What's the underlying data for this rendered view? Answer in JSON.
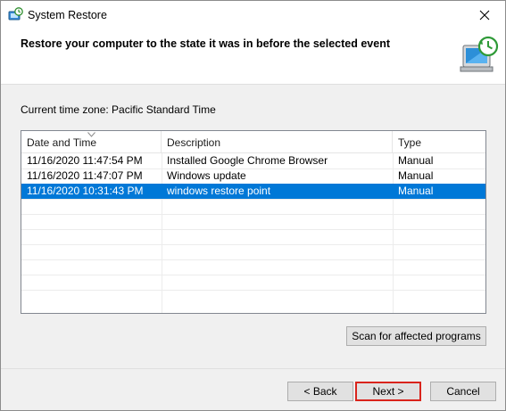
{
  "window": {
    "title": "System Restore"
  },
  "header": {
    "title": "Restore your computer to the state it was in before the selected event"
  },
  "timezone_label": "Current time zone: Pacific Standard Time",
  "table": {
    "columns": [
      "Date and Time",
      "Description",
      "Type"
    ],
    "rows": [
      {
        "date": "11/16/2020 11:47:54 PM",
        "description": "Installed Google Chrome Browser",
        "type": "Manual",
        "selected": false
      },
      {
        "date": "11/16/2020 11:47:07 PM",
        "description": "Windows update",
        "type": "Manual",
        "selected": false
      },
      {
        "date": "11/16/2020 10:31:43 PM",
        "description": "windows restore point",
        "type": "Manual",
        "selected": true
      }
    ]
  },
  "buttons": {
    "scan": "Scan for affected programs",
    "back": "< Back",
    "next": "Next >",
    "cancel": "Cancel"
  },
  "colors": {
    "selection": "#0078d7",
    "highlight_border": "#d9241c"
  },
  "icons": {
    "title": "system-restore-icon",
    "close": "close-icon",
    "header": "restore-computer-icon",
    "sort": "sort-arrow-icon"
  }
}
